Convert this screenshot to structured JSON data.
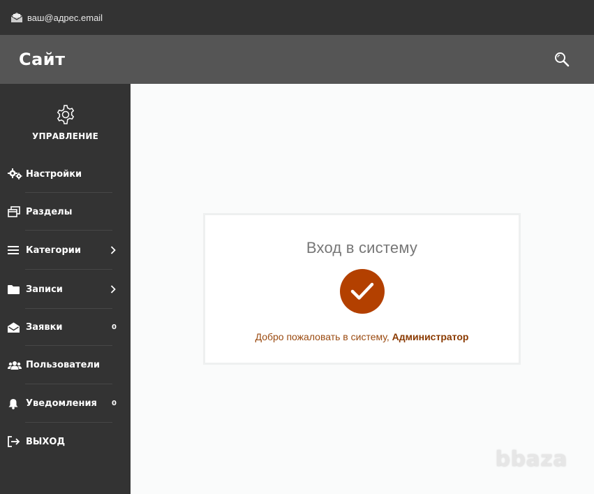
{
  "topbar": {
    "email": "ваш@адрес.email",
    "email_icon": "envelope-open-icon"
  },
  "header": {
    "site_title": "Сайт",
    "search_icon": "search-icon"
  },
  "sidebar": {
    "management_label": "УПРАВЛЕНИЕ",
    "management_icon": "gear-icon",
    "items": [
      {
        "label": "Настройки",
        "icon": "gears-icon"
      },
      {
        "label": "Разделы",
        "icon": "windows-icon"
      },
      {
        "label": "Категории",
        "icon": "list-icon",
        "has_submenu": true
      },
      {
        "label": "Записи",
        "icon": "folder-icon",
        "has_submenu": true
      },
      {
        "label": "Заявки",
        "icon": "envelope-open-icon",
        "count": "0"
      },
      {
        "label": "Пользователи",
        "icon": "users-icon"
      },
      {
        "label": "Уведомления",
        "icon": "bell-icon",
        "count": "0"
      },
      {
        "label": "ВЫХОД",
        "icon": "sign-out-icon"
      }
    ]
  },
  "login_card": {
    "title": "Вход в систему",
    "check_icon": "check-circle-icon",
    "welcome_text": "Добро пожаловать в систему, ",
    "user_name": "Администратор"
  },
  "watermark": "bbaza",
  "colors": {
    "topbar": "#333333",
    "header": "#555555",
    "sidebar": "#333333",
    "accent": "#b34000",
    "welcome_text": "#9a4a10"
  }
}
